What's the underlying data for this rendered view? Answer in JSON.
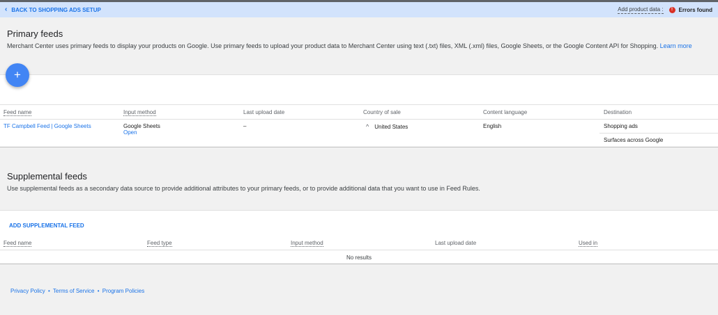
{
  "topbar": {
    "back_label": "BACK TO SHOPPING ADS SETUP",
    "add_product_label": "Add product data :",
    "error_badge": "!",
    "error_text": "Errors found"
  },
  "primary": {
    "title": "Primary feeds",
    "description": "Merchant Center uses primary feeds to display your products on Google. Use primary feeds to upload your product data to Merchant Center using text (.txt) files, XML (.xml) files, Google Sheets, or the Google Content API for Shopping. ",
    "learn_more": "Learn more",
    "add_icon": "+",
    "columns": [
      "Feed name",
      "Input method",
      "Last upload date",
      "Country of sale",
      "Content language",
      "Destination"
    ],
    "row": {
      "feed_name": "TF Campbell Feed | Google Sheets",
      "input_method": "Google Sheets",
      "open_link": "Open",
      "last_upload": "–",
      "country_icon": "^",
      "country": "United States",
      "language": "English",
      "destinations": [
        "Shopping ads",
        "Surfaces across Google"
      ]
    }
  },
  "supplemental": {
    "title": "Supplemental feeds",
    "description": "Use supplemental feeds as a secondary data source to provide additional attributes to your primary feeds, or to provide additional data that you want to use in Feed Rules.",
    "add_label": "ADD SUPPLEMENTAL FEED",
    "columns": [
      "Feed name",
      "Feed type",
      "Input method",
      "Last upload date",
      "Used in"
    ],
    "empty_text": "No results"
  },
  "footer": {
    "links": [
      "Privacy Policy",
      "Terms of Service",
      "Program Policies"
    ],
    "separator": "•"
  }
}
